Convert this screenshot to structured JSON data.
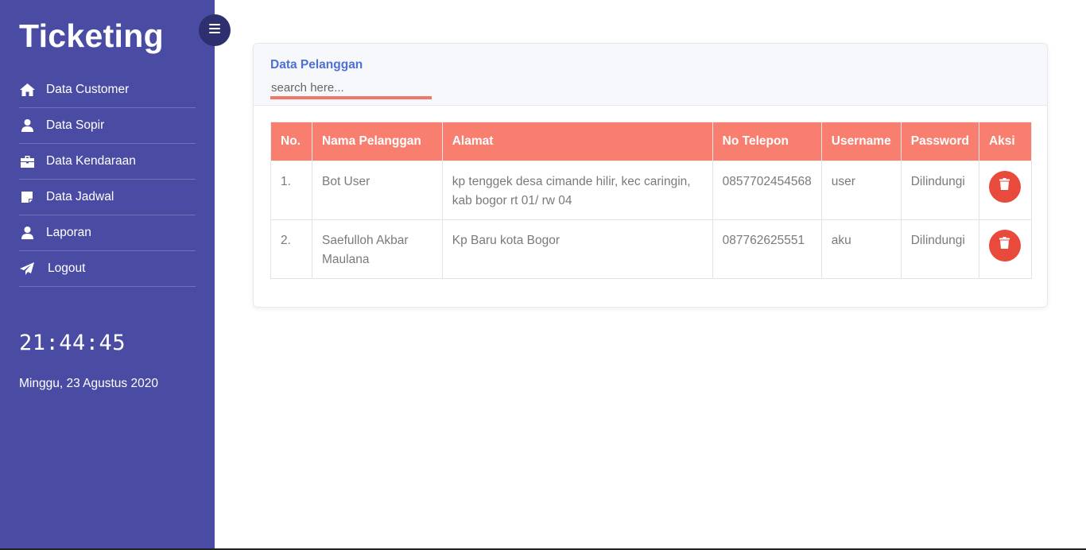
{
  "app": {
    "brand": "Ticketing"
  },
  "sidebar": {
    "items": [
      {
        "label": "Data Customer",
        "icon": "home-icon"
      },
      {
        "label": "Data Sopir",
        "icon": "user-icon"
      },
      {
        "label": "Data Kendaraan",
        "icon": "briefcase-icon"
      },
      {
        "label": "Data Jadwal",
        "icon": "sticky-note-icon"
      },
      {
        "label": "Laporan",
        "icon": "user-icon"
      },
      {
        "label": "Logout",
        "icon": "paper-plane-icon"
      }
    ],
    "clock": "21:44:45",
    "date": "Minggu, 23 Agustus 2020"
  },
  "toggle": {
    "icon": "menu-icon"
  },
  "card": {
    "title": "Data Pelanggan",
    "search_placeholder": "search here..."
  },
  "table": {
    "headers": [
      "No.",
      "Nama Pelanggan",
      "Alamat",
      "No Telepon",
      "Username",
      "Password",
      "Aksi"
    ],
    "rows": [
      {
        "no": "1.",
        "nama": "Bot User",
        "alamat": "kp tenggek desa cimande hilir, kec caringin, kab bogor rt 01/ rw 04",
        "telepon": "0857702454568",
        "username": "user",
        "password": "Dilindungi"
      },
      {
        "no": "2.",
        "nama": "Saefulloh Akbar Maulana",
        "alamat": "Kp Baru kota Bogor",
        "telepon": "087762625551",
        "username": "aku",
        "password": "Dilindungi"
      }
    ],
    "action_icon": "trash-icon"
  },
  "colors": {
    "sidebar": "#4a4ba3",
    "table_header": "#f87f6f",
    "delete_button": "#e84a3c",
    "title": "#4e6fd6"
  }
}
